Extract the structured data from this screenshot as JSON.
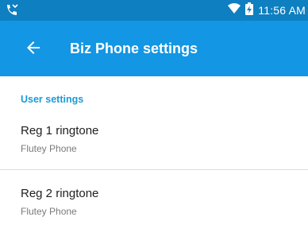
{
  "status_bar": {
    "time": "11:56 AM",
    "left_icon": "missed-call-icon",
    "wifi_icon": "wifi-icon",
    "battery_icon": "battery-charging-icon"
  },
  "toolbar": {
    "back_icon": "back-arrow-icon",
    "title": "Biz Phone settings"
  },
  "section": {
    "header": "User settings"
  },
  "items": [
    {
      "title": "Reg 1 ringtone",
      "summary": "Flutey Phone"
    },
    {
      "title": "Reg 2 ringtone",
      "summary": "Flutey Phone"
    }
  ],
  "colors": {
    "status_bar": "#0e7fc0",
    "toolbar": "#1396e3",
    "accent": "#1d9ad9"
  }
}
